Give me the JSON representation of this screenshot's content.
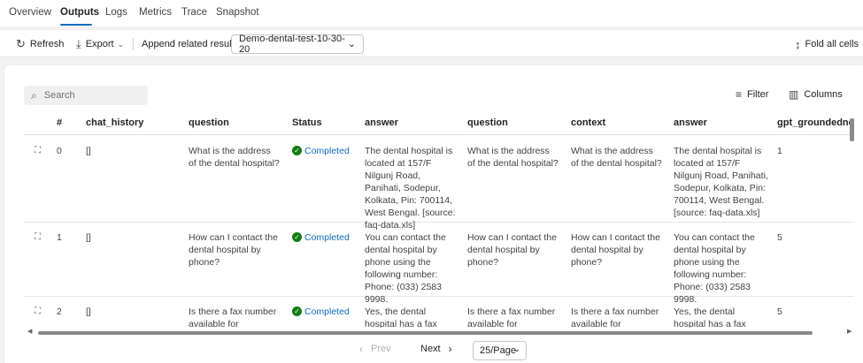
{
  "tabs": [
    {
      "label": "Overview"
    },
    {
      "label": "Outputs"
    },
    {
      "label": "Logs"
    },
    {
      "label": "Metrics"
    },
    {
      "label": "Trace"
    },
    {
      "label": "Snapshot"
    }
  ],
  "toolbar": {
    "refresh_label": "Refresh",
    "export_label": "Export",
    "append_label": "Append related results",
    "run_selected": "Demo-dental-test-10-30-20",
    "fold_label": "Fold all cells"
  },
  "table_tools": {
    "search_placeholder": "Search",
    "filter_label": "Filter",
    "columns_label": "Columns"
  },
  "table": {
    "headers": [
      "#",
      "chat_history",
      "question",
      "Status",
      "answer",
      "question",
      "context",
      "answer",
      "gpt_groundednes"
    ],
    "rows": [
      {
        "index": "0",
        "chat_history": "[]",
        "question": "What is the address of the dental hospital?",
        "status": "Completed",
        "answer": "The dental hospital is located at 157/F Nilgunj Road, Panihati, Sodepur, Kolkata, Pin: 700114, West Bengal. [source: faq-data.xls]",
        "question2": "What is the address of the dental hospital?",
        "context": "What is the address of the dental hospital?",
        "answer2": "The dental hospital is located at 157/F Nilgunj Road, Panihati, Sodepur, Kolkata, Pin: 700114, West Bengal. [source: faq-data.xls]",
        "groundedness": "1"
      },
      {
        "index": "1",
        "chat_history": "[]",
        "question": "How can I contact the dental hospital by phone?",
        "status": "Completed",
        "answer": "You can contact the dental hospital by phone using the following number: Phone: (033) 2583 9998.",
        "question2": "How can I contact the dental hospital by phone?",
        "context": "How can I contact the dental hospital by phone?",
        "answer2": "You can contact the dental hospital by phone using the following number: Phone: (033) 2583 9998.",
        "groundedness": "5"
      },
      {
        "index": "2",
        "chat_history": "[]",
        "question": "Is there a fax number available for",
        "status": "Completed",
        "answer": "Yes, the dental hospital has a fax number for",
        "question2": "Is there a fax number available for",
        "context": "Is there a fax number available for",
        "answer2": "Yes, the dental hospital has a fax number for",
        "groundedness": "5"
      }
    ]
  },
  "pagination": {
    "prev_label": "Prev",
    "next_label": "Next",
    "page_size": "25/Page"
  }
}
